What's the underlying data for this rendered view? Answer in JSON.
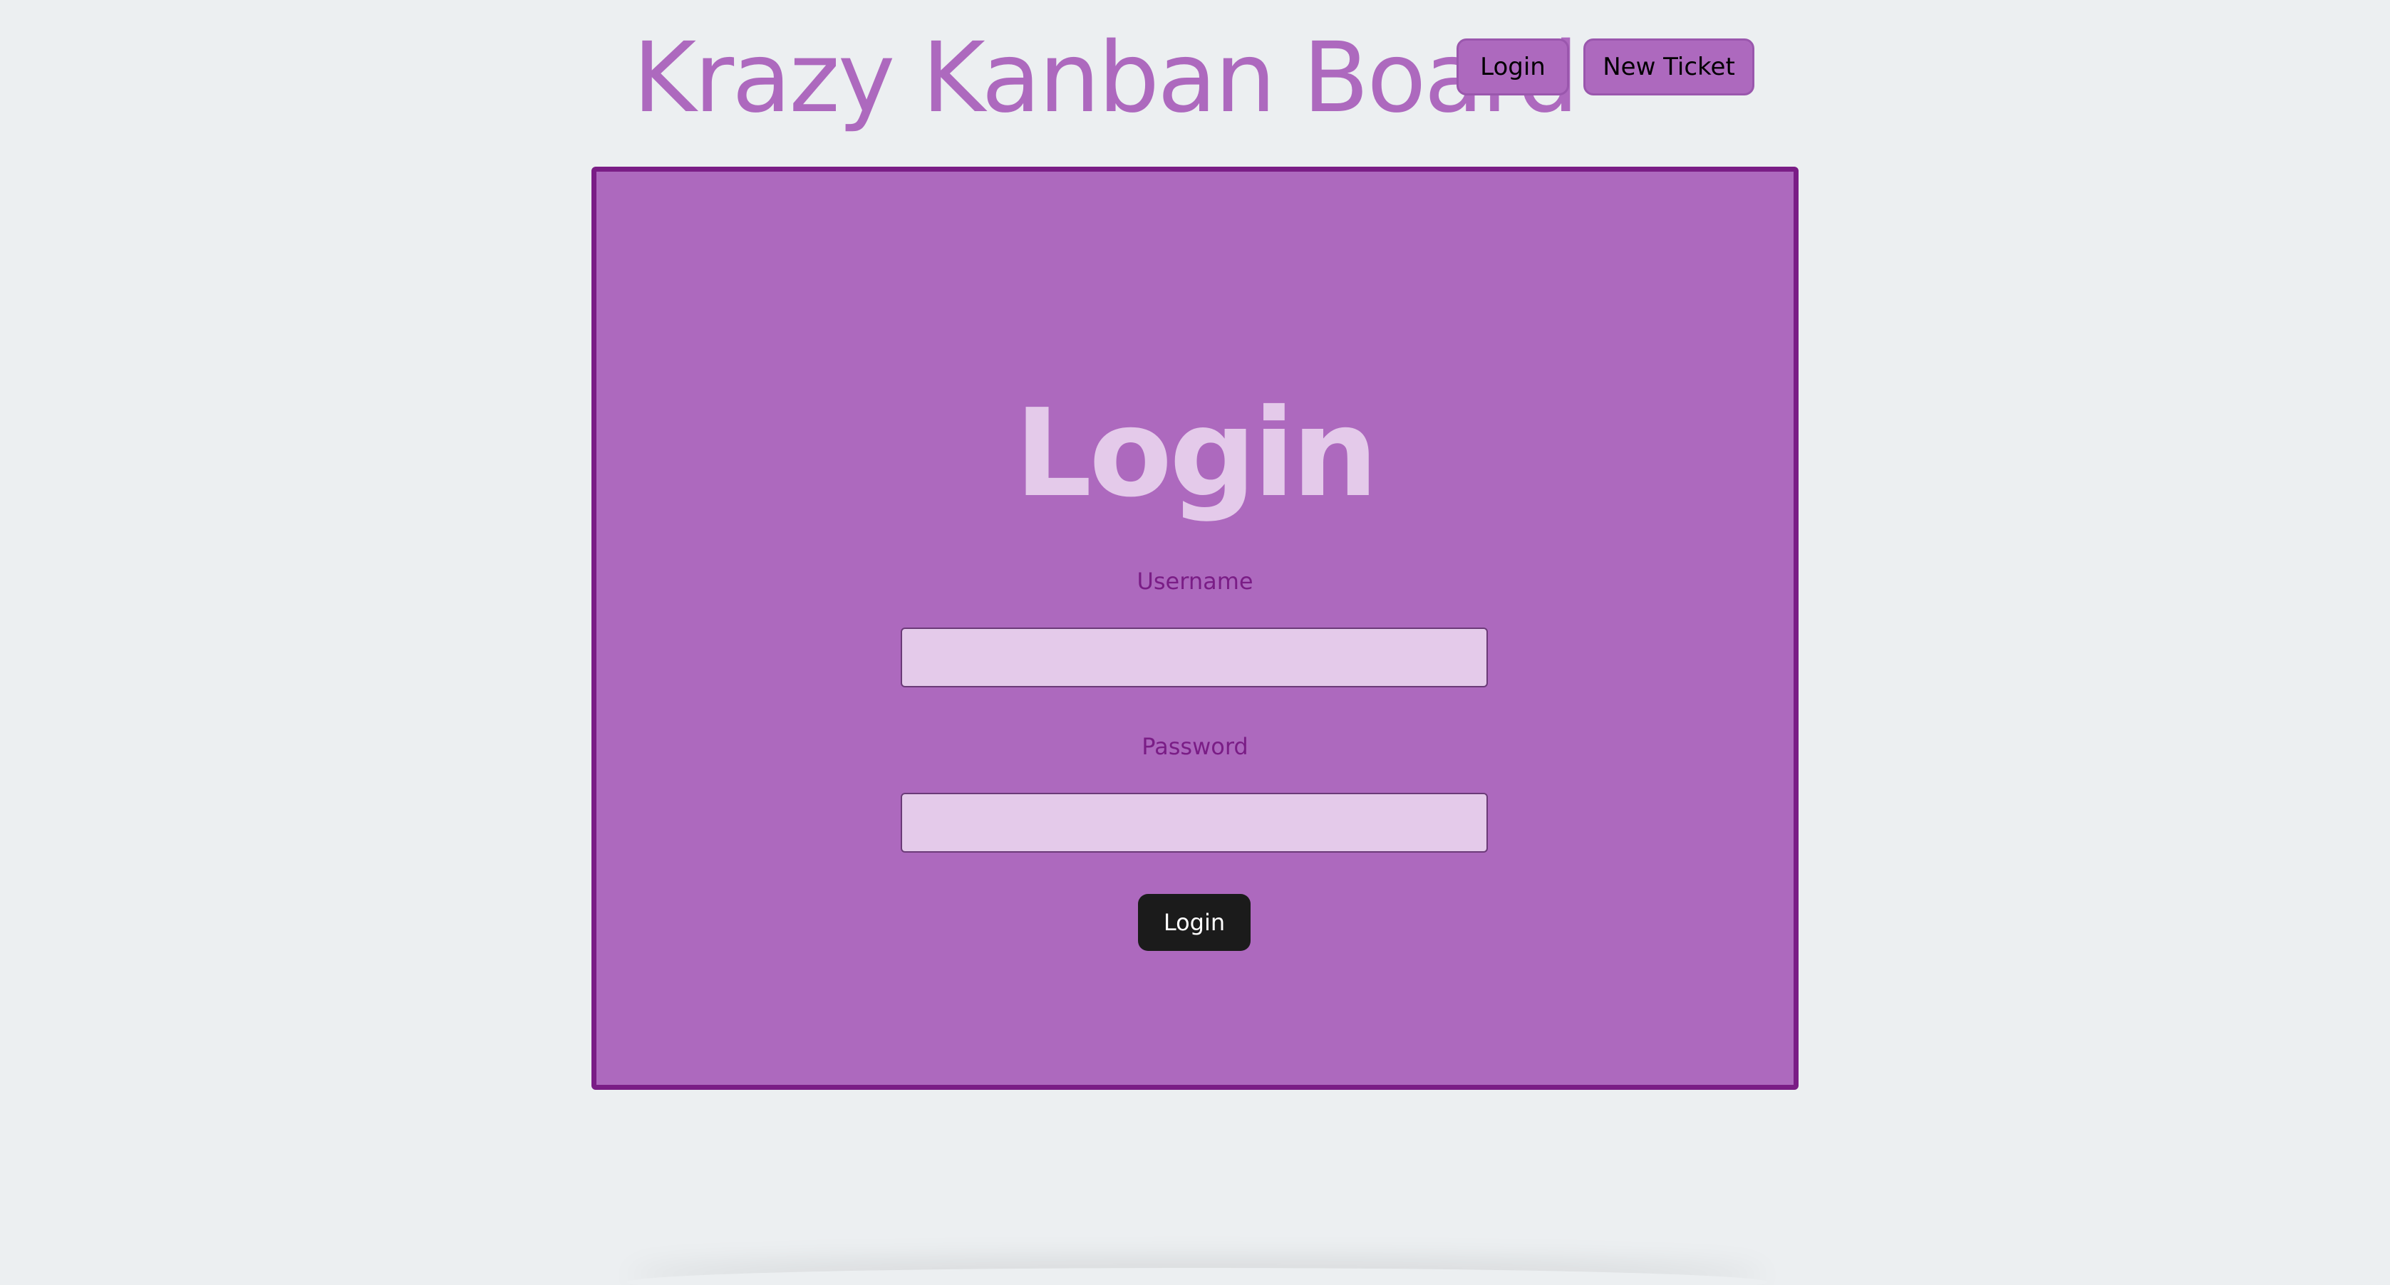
{
  "header": {
    "title": "Krazy Kanban Board",
    "nav": {
      "login_label": "Login",
      "new_ticket_label": "New Ticket"
    }
  },
  "login_form": {
    "title": "Login",
    "username_label": "Username",
    "username_value": "",
    "password_label": "Password",
    "password_value": "",
    "submit_label": "Login"
  },
  "colors": {
    "background": "#eceff1",
    "accent": "#ad69be",
    "panel_border": "#7a1d86",
    "input_fill": "#e4caea",
    "submit_button": "#1b1b1b"
  }
}
